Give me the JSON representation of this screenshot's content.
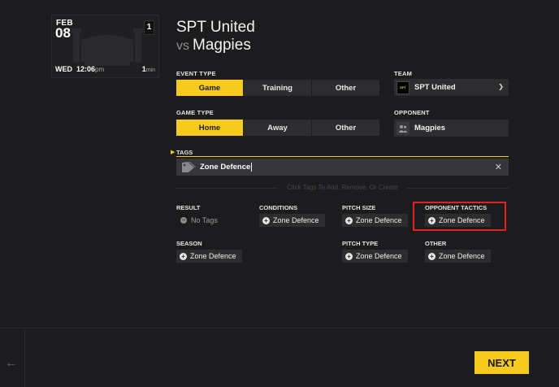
{
  "card": {
    "month": "FEB",
    "day": "08",
    "count": "1",
    "weekday": "WED",
    "time": "12:06",
    "ampm": "pm",
    "duration": "1",
    "duration_unit": "min"
  },
  "header": {
    "team": "SPT United",
    "vs": "vs",
    "opponent": "Magpies"
  },
  "event_type": {
    "label": "EVENT TYPE",
    "options": [
      "Game",
      "Training",
      "Other"
    ],
    "selected": "Game"
  },
  "game_type": {
    "label": "GAME TYPE",
    "options": [
      "Home",
      "Away",
      "Other"
    ],
    "selected": "Home"
  },
  "team_select": {
    "label": "TEAM",
    "value": "SPT United",
    "logo_text": "SPT"
  },
  "opponent_select": {
    "label": "OPPONENT",
    "value": "Magpies"
  },
  "tags": {
    "label": "TAGS",
    "input_value": "Zone Defence",
    "hint": "Click Tags To Add, Remove, Or Create"
  },
  "categories": {
    "result": {
      "label": "RESULT",
      "value": "No Tags"
    },
    "conditions": {
      "label": "CONDITIONS",
      "chip": "Zone Defence"
    },
    "pitch_size": {
      "label": "PITCH SIZE",
      "chip": "Zone Defence"
    },
    "opponent_tactics": {
      "label": "OPPONENT TACTICS",
      "chip": "Zone Defence"
    },
    "season": {
      "label": "SEASON",
      "chip": "Zone Defence"
    },
    "pitch_type": {
      "label": "PITCH TYPE",
      "chip": "Zone Defence"
    },
    "other": {
      "label": "OTHER",
      "chip": "Zone Defence"
    }
  },
  "footer": {
    "next_label": "NEXT"
  },
  "colors": {
    "accent": "#f6cb1d",
    "background": "#1c1c1e",
    "highlight": "#e02424"
  }
}
